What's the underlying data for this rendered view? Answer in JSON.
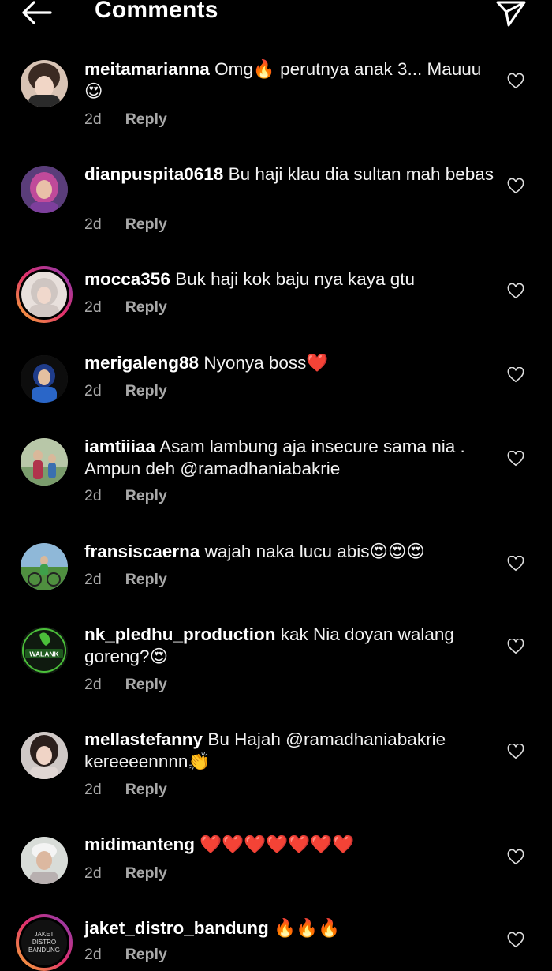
{
  "header": {
    "title": "Comments",
    "back_icon": "arrow-left-icon",
    "share_icon": "paper-plane-icon"
  },
  "comments": [
    {
      "username": "meitamarianna",
      "text": "Omg🔥 perutnya anak 3... Mauuu 😍",
      "time": "2d",
      "reply": "Reply"
    },
    {
      "username": "dianpuspita0618",
      "text": "Bu haji klau dia sultan mah bebas",
      "time": "2d",
      "reply": "Reply"
    },
    {
      "username": "mocca356",
      "text": "Buk haji kok baju nya kaya gtu",
      "time": "2d",
      "reply": "Reply"
    },
    {
      "username": "merigaleng88",
      "text": "Nyonya boss❤️",
      "time": "2d",
      "reply": "Reply"
    },
    {
      "username": "iamtiiiaa",
      "text": "Asam lambung aja insecure sama nia . Ampun deh @ramadhaniabakrie",
      "time": "2d",
      "reply": "Reply"
    },
    {
      "username": "fransiscaerna",
      "text": "wajah naka lucu abis😍😍😍",
      "time": "2d",
      "reply": "Reply"
    },
    {
      "username": "nk_pledhu_production",
      "text": "kak Nia doyan walang goreng?😍",
      "time": "2d",
      "reply": "Reply"
    },
    {
      "username": "mellastefanny",
      "text": "Bu Hajah @ramadhaniabakrie kereeeennnn👏",
      "time": "2d",
      "reply": "Reply"
    },
    {
      "username": "midimanteng",
      "text": "❤️❤️❤️❤️❤️❤️❤️",
      "time": "2d",
      "reply": "Reply"
    },
    {
      "username": "jaket_distro_bandung",
      "text": "🔥🔥🔥",
      "time": "2d",
      "reply": "Reply"
    }
  ],
  "avatar_logos": {
    "walank": "WALANK",
    "distro": [
      "JAKET",
      "DISTRO",
      "BANDUNG"
    ]
  },
  "colors": {
    "background": "#000000",
    "text": "#ffffff",
    "meta": "#a8a8a8",
    "story_ring": [
      "#f9b233",
      "#e1306c",
      "#833ab4"
    ]
  },
  "icons": {
    "like": "heart-outline-icon"
  }
}
